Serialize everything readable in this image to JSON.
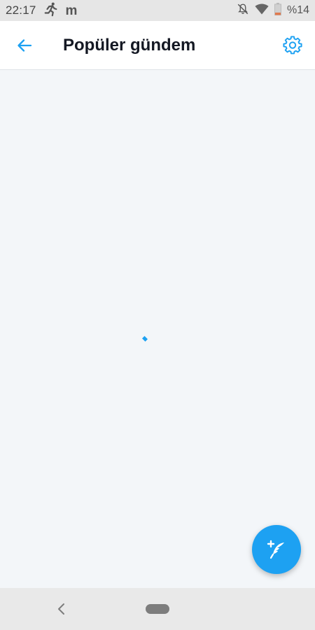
{
  "status_bar": {
    "time": "22:17",
    "battery_percent": "%14",
    "icons": [
      "running-icon",
      "m-app-icon",
      "notifications-off-icon",
      "wifi-icon",
      "battery-icon"
    ],
    "m_glyph": "m"
  },
  "app_bar": {
    "title": "Popüler gündem",
    "back_icon": "arrow-left-icon",
    "settings_icon": "gear-icon"
  },
  "content": {
    "state": "loading"
  },
  "fab": {
    "icon": "compose-feather-icon"
  },
  "nav_bar": {
    "back_icon": "chevron-left-icon",
    "home_icon": "home-pill-icon"
  },
  "colors": {
    "accent": "#1da1f2",
    "background": "#f3f6f9",
    "status_bar": "#e6e6e6",
    "nav_bar": "#e9e9e9"
  }
}
